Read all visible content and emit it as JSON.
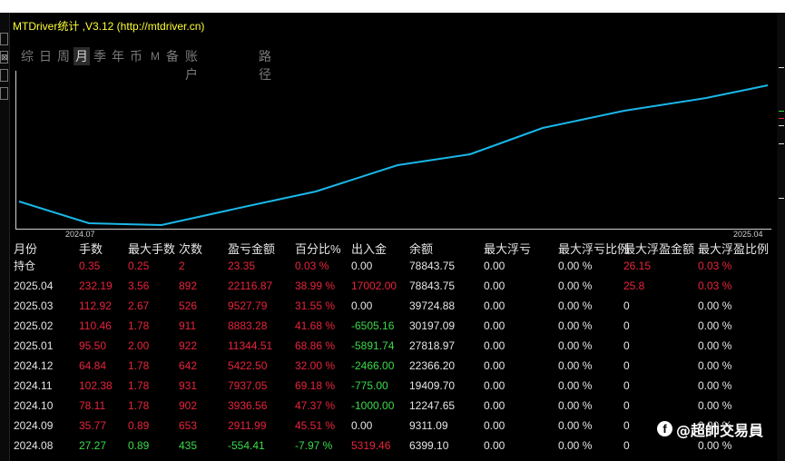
{
  "window": {
    "title": "MTDriver统计 ,V3.12 (http://mtdriver.cn)"
  },
  "tabs": [
    {
      "label": "综"
    },
    {
      "label": "日"
    },
    {
      "label": "周"
    },
    {
      "label": "月"
    },
    {
      "label": "季"
    },
    {
      "label": "年"
    },
    {
      "label": "币"
    },
    {
      "label": "M"
    },
    {
      "label": "备"
    },
    {
      "label": "账户"
    },
    {
      "label": "路径"
    }
  ],
  "active_tab": "月",
  "colors": {
    "line": "#1ab7e8",
    "positive": "#3bdb4a",
    "negative": "#e8243c",
    "title": "#ffff33"
  },
  "chart_data": {
    "type": "line",
    "x_start_label": "2024.07",
    "x_end_label": "2025.04",
    "series": [
      {
        "values": [
          6399.1,
          6050,
          5950,
          6399.1,
          9311.09,
          12247.65,
          19409.7,
          22366.2,
          27818.97,
          30197.09,
          39724.88,
          78843.75
        ]
      }
    ]
  },
  "table": {
    "headers": [
      "月份",
      "手数",
      "最大手数",
      "次数",
      "盈亏金额",
      "百分比%",
      "出入金",
      "余额",
      "最大浮亏",
      "最大浮亏比例",
      "最大浮盈金额",
      "最大浮盈比例"
    ],
    "rows": [
      {
        "cells": [
          "持仓",
          "0.35",
          "0.25",
          "2",
          "23.35",
          "0.03 %",
          "0.00",
          "78843.75",
          "0.00",
          "0.00 %",
          "26.15",
          "0.03 %"
        ],
        "colors": [
          "l",
          "r",
          "r",
          "r",
          "r",
          "r",
          "l",
          "l",
          "l",
          "l",
          "r",
          "r"
        ]
      },
      {
        "cells": [
          "2025.04",
          "232.19",
          "3.56",
          "892",
          "22116.87",
          "38.99 %",
          "17002.00",
          "78843.75",
          "0.00",
          "0.00 %",
          "25.8",
          "0.03 %"
        ],
        "colors": [
          "l",
          "r",
          "r",
          "r",
          "r",
          "r",
          "r",
          "l",
          "l",
          "l",
          "r",
          "r"
        ]
      },
      {
        "cells": [
          "2025.03",
          "112.92",
          "2.67",
          "526",
          "9527.79",
          "31.55 %",
          "0.00",
          "39724.88",
          "0.00",
          "0.00 %",
          "0",
          "0.00 %"
        ],
        "colors": [
          "l",
          "r",
          "r",
          "r",
          "r",
          "r",
          "l",
          "l",
          "l",
          "l",
          "l",
          "l"
        ]
      },
      {
        "cells": [
          "2025.02",
          "110.46",
          "1.78",
          "911",
          "8883.28",
          "41.68 %",
          "-6505.16",
          "30197.09",
          "0.00",
          "0.00 %",
          "0",
          "0.00 %"
        ],
        "colors": [
          "l",
          "r",
          "r",
          "r",
          "r",
          "r",
          "g",
          "l",
          "l",
          "l",
          "l",
          "l"
        ]
      },
      {
        "cells": [
          "2025.01",
          "95.50",
          "2.00",
          "922",
          "11344.51",
          "68.86 %",
          "-5891.74",
          "27818.97",
          "0.00",
          "0.00 %",
          "0",
          "0.00 %"
        ],
        "colors": [
          "l",
          "r",
          "r",
          "r",
          "r",
          "r",
          "g",
          "l",
          "l",
          "l",
          "l",
          "l"
        ]
      },
      {
        "cells": [
          "2024.12",
          "64.84",
          "1.78",
          "642",
          "5422.50",
          "32.00 %",
          "-2466.00",
          "22366.20",
          "0.00",
          "0.00 %",
          "0",
          "0.00 %"
        ],
        "colors": [
          "l",
          "r",
          "r",
          "r",
          "r",
          "r",
          "g",
          "l",
          "l",
          "l",
          "l",
          "l"
        ]
      },
      {
        "cells": [
          "2024.11",
          "102.38",
          "1.78",
          "931",
          "7937.05",
          "69.18 %",
          "-775.00",
          "19409.70",
          "0.00",
          "0.00 %",
          "0",
          "0.00 %"
        ],
        "colors": [
          "l",
          "r",
          "r",
          "r",
          "r",
          "r",
          "g",
          "l",
          "l",
          "l",
          "l",
          "l"
        ]
      },
      {
        "cells": [
          "2024.10",
          "78.11",
          "1.78",
          "902",
          "3936.56",
          "47.37 %",
          "-1000.00",
          "12247.65",
          "0.00",
          "0.00 %",
          "0",
          "0.00 %"
        ],
        "colors": [
          "l",
          "r",
          "r",
          "r",
          "r",
          "r",
          "g",
          "l",
          "l",
          "l",
          "l",
          "l"
        ]
      },
      {
        "cells": [
          "2024.09",
          "35.77",
          "0.89",
          "653",
          "2911.99",
          "45.51 %",
          "0.00",
          "9311.09",
          "0.00",
          "0.00 %",
          "0",
          "0.00 %"
        ],
        "colors": [
          "l",
          "r",
          "r",
          "r",
          "r",
          "r",
          "l",
          "l",
          "l",
          "l",
          "l",
          "l"
        ]
      },
      {
        "cells": [
          "2024.08",
          "27.27",
          "0.89",
          "435",
          "-554.41",
          "-7.97 %",
          "5319.46",
          "6399.10",
          "0.00",
          "0.00 %",
          "0",
          "0.00 %"
        ],
        "colors": [
          "l",
          "g",
          "g",
          "g",
          "g",
          "g",
          "r",
          "l",
          "l",
          "l",
          "l",
          "l"
        ]
      }
    ]
  },
  "watermark": {
    "text": "@超帥交易員",
    "icon": "facebook-icon"
  }
}
